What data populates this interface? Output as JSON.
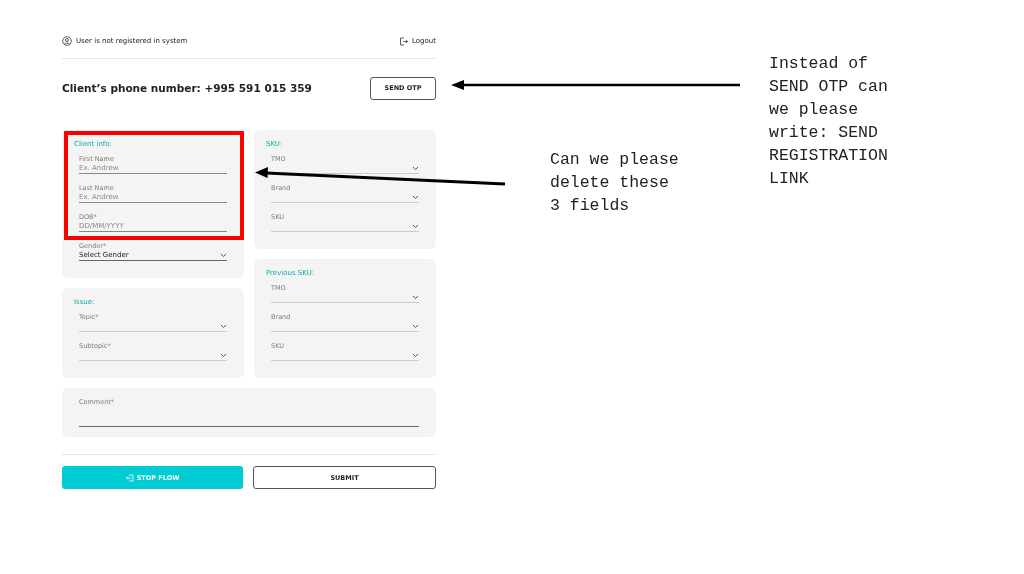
{
  "header": {
    "status": "User is not registered in system",
    "logout": "Logout"
  },
  "phone": {
    "label": "Client’s phone number: +995 591 015 359",
    "button": "SEND OTP"
  },
  "left_cards": [
    {
      "title": "Client info:",
      "fields": [
        {
          "kind": "text",
          "label": "First Name",
          "placeholder": "Ex. Andrew"
        },
        {
          "kind": "text",
          "label": "Last Name",
          "placeholder": "Ex. Andrew"
        },
        {
          "kind": "text",
          "label": "DOB*",
          "placeholder": "DD/MM/YYYY"
        },
        {
          "kind": "select",
          "label": "Gender*",
          "value": "Select Gender"
        }
      ]
    },
    {
      "title": "Issue:",
      "fields": [
        {
          "kind": "select",
          "label": "Topic*"
        },
        {
          "kind": "select",
          "label": "Subtopic*"
        }
      ]
    }
  ],
  "right_cards": [
    {
      "title": "SKU:",
      "fields": [
        {
          "kind": "select",
          "label": "TMO"
        },
        {
          "kind": "select",
          "label": "Brand"
        },
        {
          "kind": "select",
          "label": "SKU"
        }
      ]
    },
    {
      "title": "Previous SKU:",
      "fields": [
        {
          "kind": "select",
          "label": "TMO"
        },
        {
          "kind": "select",
          "label": "Brand"
        },
        {
          "kind": "select",
          "label": "SKU"
        }
      ]
    }
  ],
  "comment": {
    "label": "Comment*"
  },
  "buttons": {
    "stop": "STOP FLOW",
    "submit": "SUBMIT"
  },
  "annotations": [
    {
      "lines": [
        "Instead of",
        "SEND OTP can",
        "we please",
        "write: SEND",
        "REGISTRATION",
        "LINK"
      ]
    },
    {
      "lines": [
        "Can we please",
        "delete these",
        "3 fields"
      ]
    }
  ]
}
